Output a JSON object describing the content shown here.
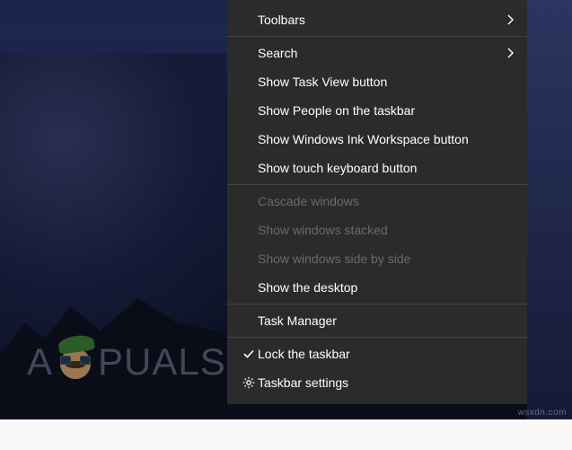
{
  "context_menu": {
    "sections": [
      {
        "items": [
          {
            "id": "toolbars",
            "label": "Toolbars",
            "submenu": true,
            "enabled": true
          }
        ]
      },
      {
        "items": [
          {
            "id": "search",
            "label": "Search",
            "submenu": true,
            "enabled": true
          },
          {
            "id": "show-task-view",
            "label": "Show Task View button",
            "enabled": true
          },
          {
            "id": "show-people",
            "label": "Show People on the taskbar",
            "enabled": true
          },
          {
            "id": "show-ink",
            "label": "Show Windows Ink Workspace button",
            "enabled": true
          },
          {
            "id": "show-touch-kb",
            "label": "Show touch keyboard button",
            "enabled": true
          }
        ]
      },
      {
        "items": [
          {
            "id": "cascade",
            "label": "Cascade windows",
            "enabled": false
          },
          {
            "id": "stacked",
            "label": "Show windows stacked",
            "enabled": false
          },
          {
            "id": "side-by-side",
            "label": "Show windows side by side",
            "enabled": false
          },
          {
            "id": "show-desktop",
            "label": "Show the desktop",
            "enabled": true
          }
        ]
      },
      {
        "items": [
          {
            "id": "task-manager",
            "label": "Task Manager",
            "enabled": true
          }
        ]
      },
      {
        "items": [
          {
            "id": "lock-taskbar",
            "label": "Lock the taskbar",
            "enabled": true,
            "icon": "check"
          },
          {
            "id": "taskbar-settings",
            "label": "Taskbar settings",
            "enabled": true,
            "icon": "gear"
          }
        ]
      }
    ]
  },
  "logo_text_before": "A",
  "logo_text_after": "PUALS",
  "watermark": "wsxdn.com"
}
